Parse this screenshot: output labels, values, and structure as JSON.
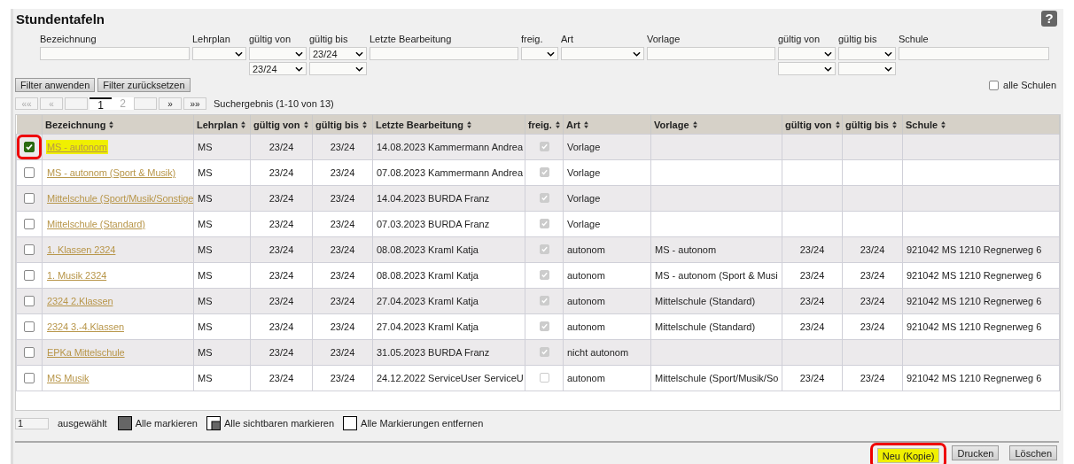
{
  "title": "Stundentafeln",
  "help_button": "?",
  "filters": [
    {
      "label": "Bezeichnung",
      "kind": "text"
    },
    {
      "label": "Lehrplan",
      "kind": "select"
    },
    {
      "label": "gültig von",
      "kind": "select2",
      "value2": "23/24"
    },
    {
      "label": "gültig bis",
      "kind": "select2",
      "value": "23/24"
    },
    {
      "label": "Letzte Bearbeitung",
      "kind": "text"
    },
    {
      "label": "freig.",
      "kind": "select"
    },
    {
      "label": "Art",
      "kind": "select"
    },
    {
      "label": "Vorlage",
      "kind": "text"
    },
    {
      "label": "gültig von",
      "kind": "select2"
    },
    {
      "label": "gültig bis",
      "kind": "select2"
    },
    {
      "label": "Schule",
      "kind": "text"
    }
  ],
  "filter_buttons": [
    "Filter anwenden",
    "Filter zurücksetzen"
  ],
  "all_schools": {
    "label": "alle Schulen",
    "checked": false
  },
  "pager": {
    "first": "««",
    "prev": "«",
    "pages": [
      {
        "label": "1",
        "selected": true
      },
      {
        "label": "2",
        "selected": false
      }
    ],
    "next": "»",
    "last": "»»",
    "result": "Suchergebnis (1-10 von 13)"
  },
  "columns": [
    "Bezeichnung",
    "Lehrplan",
    "gültig von",
    "gültig bis",
    "Letzte Bearbeitung",
    "freig.",
    "Art",
    "Vorlage",
    "gültig von",
    "gültig bis",
    "Schule"
  ],
  "rows": [
    {
      "checked": true,
      "highlighted": true,
      "circled": true,
      "name": "MS - autonom",
      "plan": "MS",
      "from": "23/24",
      "to": "23/24",
      "edit": "14.08.2023 Kammermann Andrea",
      "released": true,
      "type": "Vorlage",
      "template": "",
      "from2": "",
      "to2": "",
      "school": ""
    },
    {
      "checked": false,
      "highlighted": false,
      "circled": false,
      "name": "MS - autonom (Sport & Musik)",
      "plan": "MS",
      "from": "23/24",
      "to": "23/24",
      "edit": "07.08.2023 Kammermann Andrea",
      "released": true,
      "type": "Vorlage",
      "template": "",
      "from2": "",
      "to2": "",
      "school": ""
    },
    {
      "checked": false,
      "highlighted": false,
      "circled": false,
      "name": "Mittelschule (Sport/Musik/Sonstige",
      "plan": "MS",
      "from": "23/24",
      "to": "23/24",
      "edit": "14.04.2023 BURDA Franz",
      "released": true,
      "type": "Vorlage",
      "template": "",
      "from2": "",
      "to2": "",
      "school": ""
    },
    {
      "checked": false,
      "highlighted": false,
      "circled": false,
      "name": "Mittelschule (Standard)",
      "plan": "MS",
      "from": "23/24",
      "to": "23/24",
      "edit": "07.03.2023 BURDA Franz",
      "released": true,
      "type": "Vorlage",
      "template": "",
      "from2": "",
      "to2": "",
      "school": ""
    },
    {
      "checked": false,
      "highlighted": false,
      "circled": false,
      "name": "1. Klassen 2324",
      "plan": "MS",
      "from": "23/24",
      "to": "23/24",
      "edit": "08.08.2023 Kraml Katja",
      "released": true,
      "type": "autonom",
      "template": "MS - autonom",
      "from2": "23/24",
      "to2": "23/24",
      "school": "921042 MS 1210 Regnerweg 6"
    },
    {
      "checked": false,
      "highlighted": false,
      "circled": false,
      "name": "1. Musik 2324",
      "plan": "MS",
      "from": "23/24",
      "to": "23/24",
      "edit": "08.08.2023 Kraml Katja",
      "released": true,
      "type": "autonom",
      "template": "MS - autonom (Sport & Musi",
      "from2": "23/24",
      "to2": "23/24",
      "school": "921042 MS 1210 Regnerweg 6"
    },
    {
      "checked": false,
      "highlighted": false,
      "circled": false,
      "name": "2324 2.Klassen",
      "plan": "MS",
      "from": "23/24",
      "to": "23/24",
      "edit": "27.04.2023 Kraml Katja",
      "released": true,
      "type": "autonom",
      "template": "Mittelschule (Standard)",
      "from2": "23/24",
      "to2": "23/24",
      "school": "921042 MS 1210 Regnerweg 6"
    },
    {
      "checked": false,
      "highlighted": false,
      "circled": false,
      "name": "2324 3.-4.Klassen",
      "plan": "MS",
      "from": "23/24",
      "to": "23/24",
      "edit": "27.04.2023 Kraml Katja",
      "released": true,
      "type": "autonom",
      "template": "Mittelschule (Standard)",
      "from2": "23/24",
      "to2": "23/24",
      "school": "921042 MS 1210 Regnerweg 6"
    },
    {
      "checked": false,
      "highlighted": false,
      "circled": false,
      "name": "EPKa Mittelschule",
      "plan": "MS",
      "from": "23/24",
      "to": "23/24",
      "edit": "31.05.2023 BURDA Franz",
      "released": true,
      "type": "nicht autonom",
      "template": "",
      "from2": "",
      "to2": "",
      "school": ""
    },
    {
      "checked": false,
      "highlighted": false,
      "circled": false,
      "name": "MS Musik",
      "plan": "MS",
      "from": "23/24",
      "to": "23/24",
      "edit": "24.12.2022 ServiceUser ServiceU",
      "released": false,
      "type": "autonom",
      "template": "Mittelschule (Sport/Musik/So",
      "from2": "23/24",
      "to2": "23/24",
      "school": "921042 MS 1210 Regnerweg 6"
    }
  ],
  "selection": {
    "count": "1",
    "label": "ausgewählt",
    "actions": [
      {
        "label": "Alle markieren",
        "kind": "all"
      },
      {
        "label": "Alle sichtbaren markieren",
        "kind": "visible"
      },
      {
        "label": "Alle Markierungen entfernen",
        "kind": "none"
      }
    ]
  },
  "actions": [
    {
      "label": "Neu (Kopie)",
      "highlighted": true,
      "circled": true
    },
    {
      "label": "Drucken",
      "highlighted": false,
      "circled": false
    },
    {
      "label": "Löschen",
      "highlighted": false,
      "circled": false
    }
  ]
}
